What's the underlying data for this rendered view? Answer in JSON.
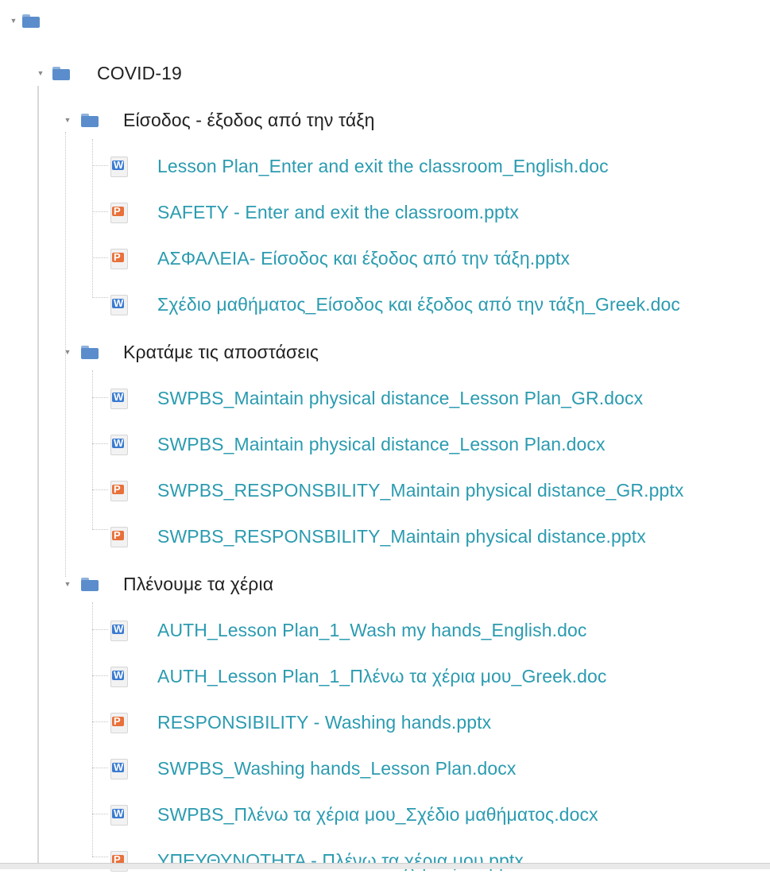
{
  "tree": {
    "root": {
      "label": ""
    },
    "category": {
      "label": "COVID-19",
      "folders": [
        {
          "label": "Είσοδος - έξοδος από την τάξη",
          "files": [
            {
              "name": "Lesson Plan_Enter and exit the classroom_English.doc",
              "type": "doc"
            },
            {
              "name": "SAFETY - Enter and exit the classroom.pptx",
              "type": "ppt"
            },
            {
              "name": "ΑΣΦΑΛΕΙΑ- Είσοδος και έξοδος από την τάξη.pptx",
              "type": "ppt"
            },
            {
              "name": "Σχέδιο μαθήματος_Είσοδος και έξοδος από την τάξη_Greek.doc",
              "type": "doc"
            }
          ]
        },
        {
          "label": "Κρατάμε τις αποστάσεις",
          "files": [
            {
              "name": "SWPBS_Maintain physical distance_Lesson Plan_GR.docx",
              "type": "doc"
            },
            {
              "name": "SWPBS_Maintain physical distance_Lesson Plan.docx",
              "type": "doc"
            },
            {
              "name": "SWPBS_RESPONSBILITY_Maintain physical distance_GR.pptx",
              "type": "ppt"
            },
            {
              "name": "SWPBS_RESPONSBILITY_Maintain physical distance.pptx",
              "type": "ppt"
            }
          ]
        },
        {
          "label": "Πλένουμε τα χέρια",
          "files": [
            {
              "name": "AUTH_Lesson Plan_1_Wash my hands_English.doc",
              "type": "doc"
            },
            {
              "name": "AUTH_Lesson Plan_1_Πλένω τα χέρια μου_Greek.doc",
              "type": "doc"
            },
            {
              "name": "RESPONSIBILITY - Washing hands.pptx",
              "type": "ppt"
            },
            {
              "name": "SWPBS_Washing hands_Lesson Plan.docx",
              "type": "doc"
            },
            {
              "name": "SWPBS_Πλένω τα χέρια μου_Σχέδιο μαθήματος.docx",
              "type": "doc"
            },
            {
              "name": "ΥΠΕΥΘΥΝΟΤΗΤΑ - Πλένω τα χέρια μου.pptx",
              "type": "ppt"
            }
          ]
        }
      ]
    }
  },
  "icons": {
    "expanded": "triangle-down",
    "folder": "folder-icon",
    "doc": "word-document-icon",
    "ppt": "powerpoint-icon"
  },
  "colors": {
    "link": "#2b9bb0",
    "folder": "#5b8dcc",
    "doc": "#3b7bd1",
    "ppt": "#e8703a",
    "guide": "#c5c5c5"
  }
}
